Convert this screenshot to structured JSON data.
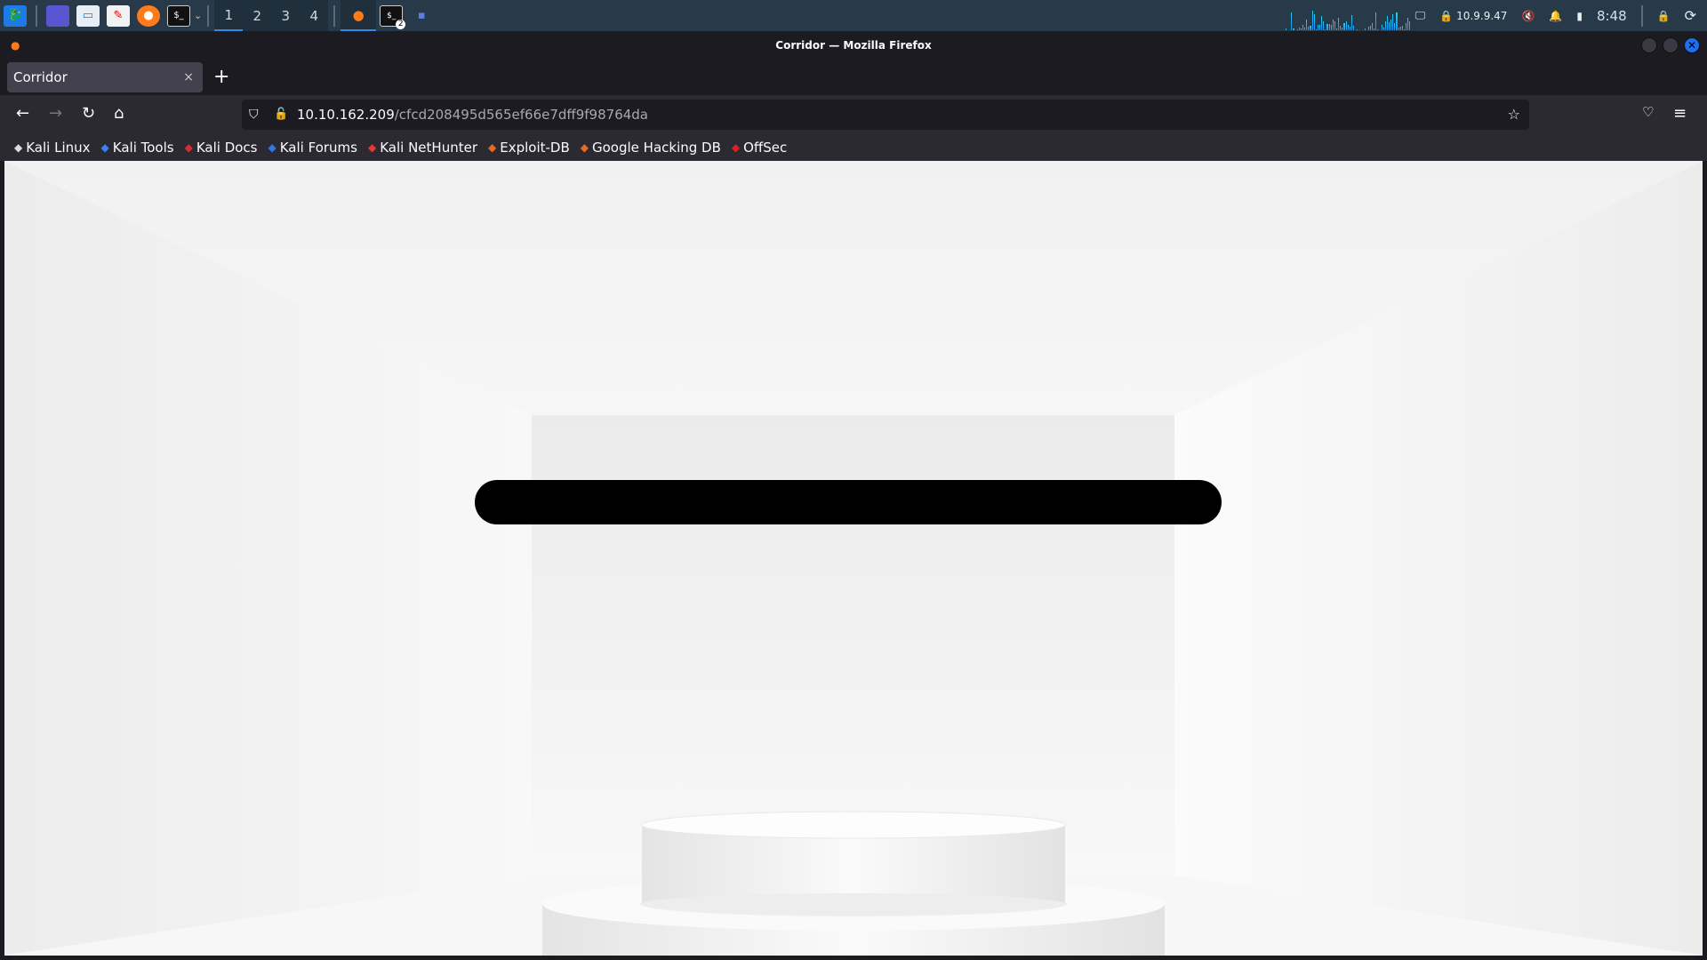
{
  "taskbar": {
    "workspaces": [
      "1",
      "2",
      "3",
      "4"
    ],
    "active_workspace": "1",
    "ip": "10.9.9.47",
    "time": "8:48",
    "terminal_badge": "2"
  },
  "window": {
    "title": "Corridor — Mozilla Firefox"
  },
  "tab": {
    "title": "Corridor",
    "close": "×",
    "new_tab": "+"
  },
  "nav": {
    "url_host": "10.10.162.209",
    "url_path": "/cfcd208495d565ef66e7dff9f98764da"
  },
  "bookmarks": [
    {
      "label": "Kali Linux",
      "icon": "kali-dragon-icon",
      "color": "#dddddd"
    },
    {
      "label": "Kali Tools",
      "icon": "kali-tools-icon",
      "color": "#3b82f6"
    },
    {
      "label": "Kali Docs",
      "icon": "kali-docs-icon",
      "color": "#d32f2f"
    },
    {
      "label": "Kali Forums",
      "icon": "kali-forums-icon",
      "color": "#2f7be0"
    },
    {
      "label": "Kali NetHunter",
      "icon": "nethunter-icon",
      "color": "#e53935"
    },
    {
      "label": "Exploit-DB",
      "icon": "exploit-db-icon",
      "color": "#e86a1f"
    },
    {
      "label": "Google Hacking DB",
      "icon": "ghdb-icon",
      "color": "#e86a1f"
    },
    {
      "label": "OffSec",
      "icon": "offsec-icon",
      "color": "#e02020"
    }
  ]
}
